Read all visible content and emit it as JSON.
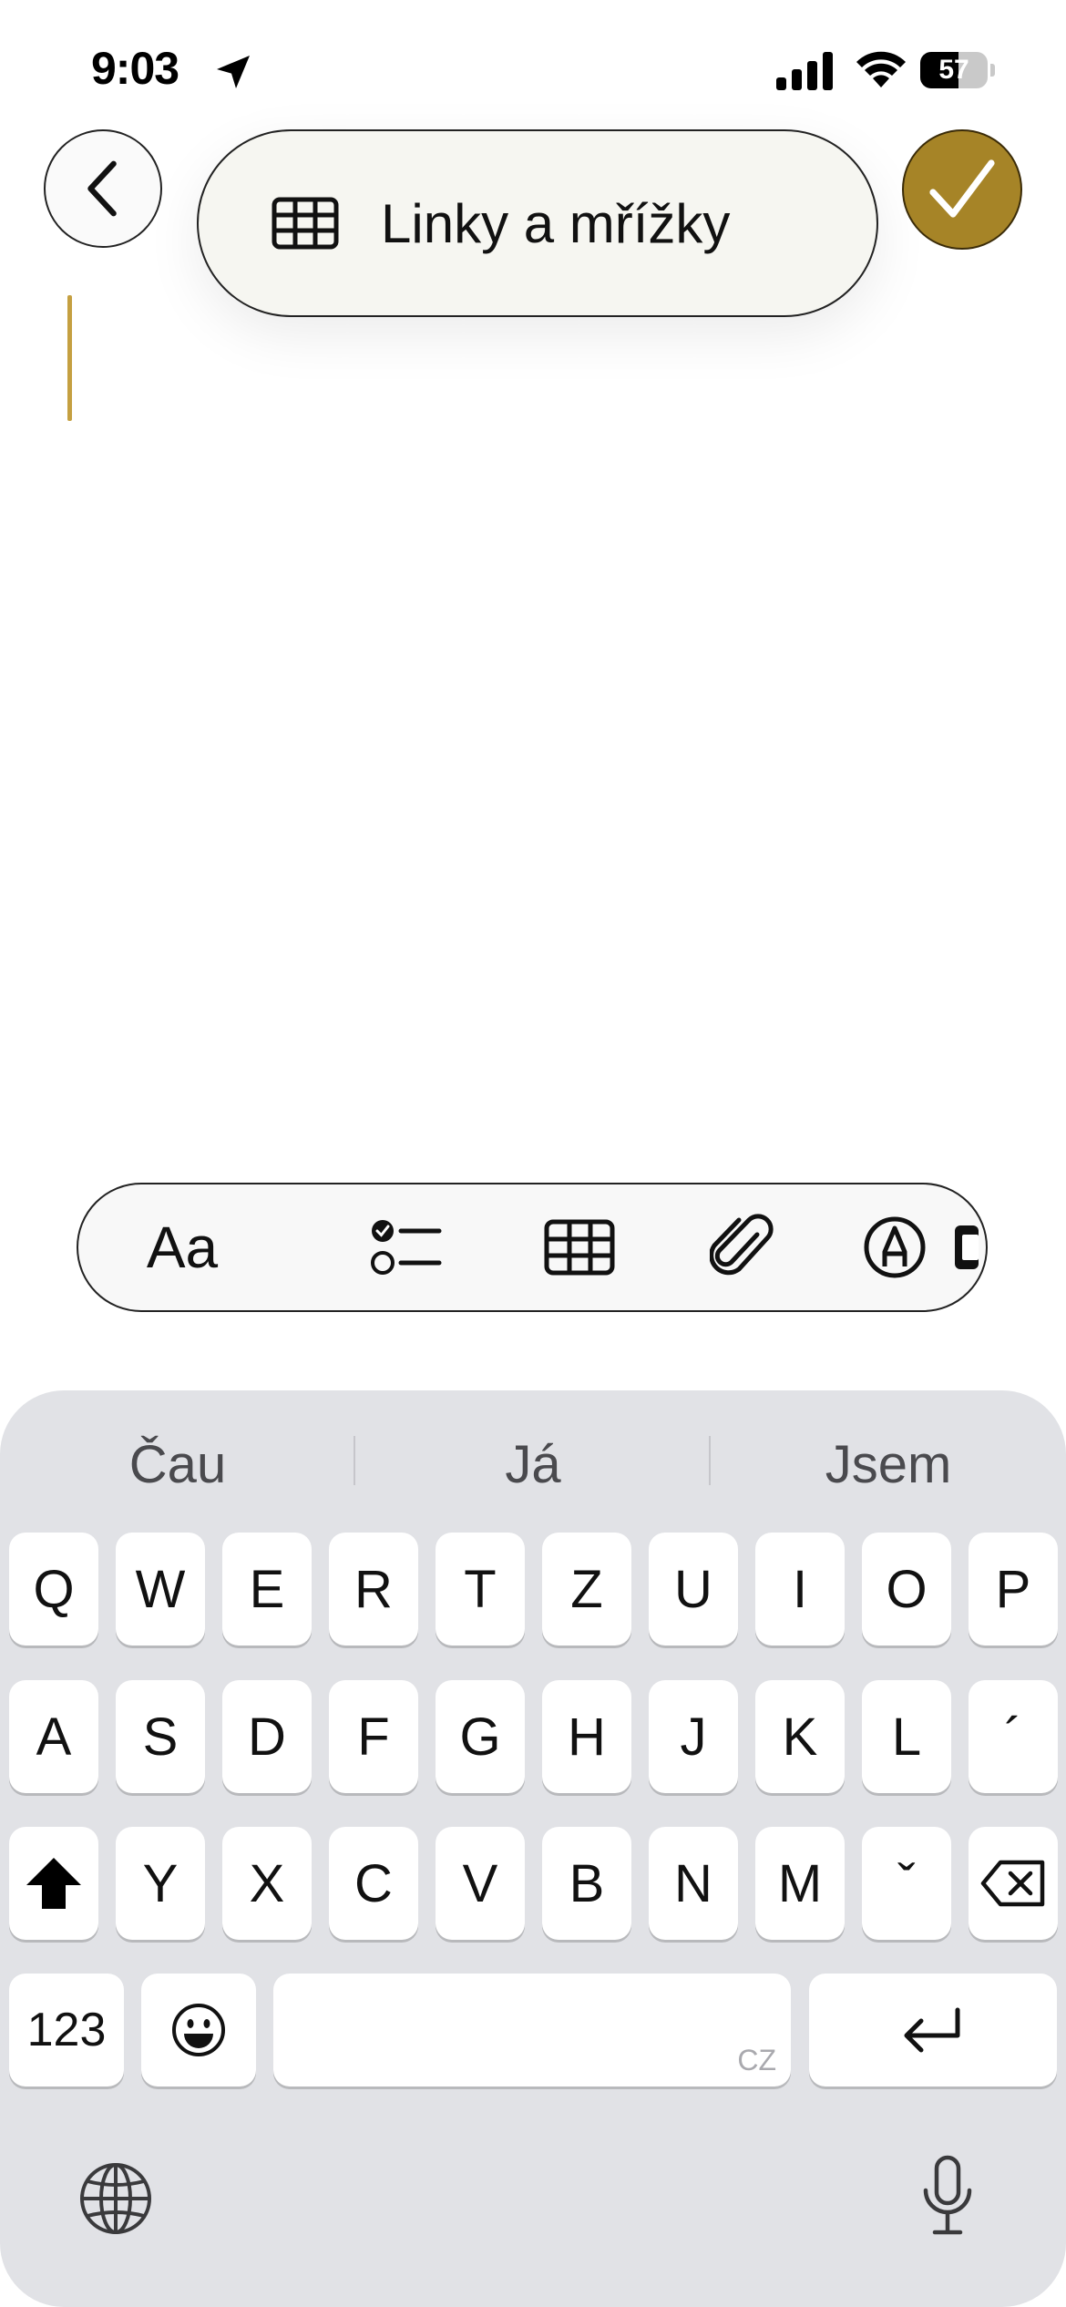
{
  "status_bar": {
    "time": "9:03",
    "battery_percent": "57",
    "battery_level": 0.57,
    "icons": [
      "location-arrow-icon",
      "cellular-signal-icon",
      "wifi-icon",
      "battery-icon"
    ]
  },
  "header": {
    "back_icon": "chevron-left-icon",
    "done_icon": "checkmark-icon",
    "accent_color": "#a68427"
  },
  "popup": {
    "icon": "table-grid-icon",
    "label": "Linky a mřížky"
  },
  "toolbar": {
    "format_label": "Aa",
    "items": [
      "text-format",
      "checklist-icon",
      "table-icon",
      "paperclip-icon",
      "markup-pen-icon",
      "more-icon"
    ]
  },
  "keyboard": {
    "suggestions": [
      "Čau",
      "Já",
      "Jsem"
    ],
    "row1": [
      "Q",
      "W",
      "E",
      "R",
      "T",
      "Z",
      "U",
      "I",
      "O",
      "P"
    ],
    "row2": [
      "A",
      "S",
      "D",
      "F",
      "G",
      "H",
      "J",
      "K",
      "L",
      "´"
    ],
    "row3": [
      "Y",
      "X",
      "C",
      "V",
      "B",
      "N",
      "M",
      "ˇ"
    ],
    "numbers_label": "123",
    "space_language": "CZ",
    "emoji_icon": "emoji-icon",
    "return_icon": "return-icon",
    "globe_icon": "globe-icon",
    "mic_icon": "microphone-icon"
  }
}
